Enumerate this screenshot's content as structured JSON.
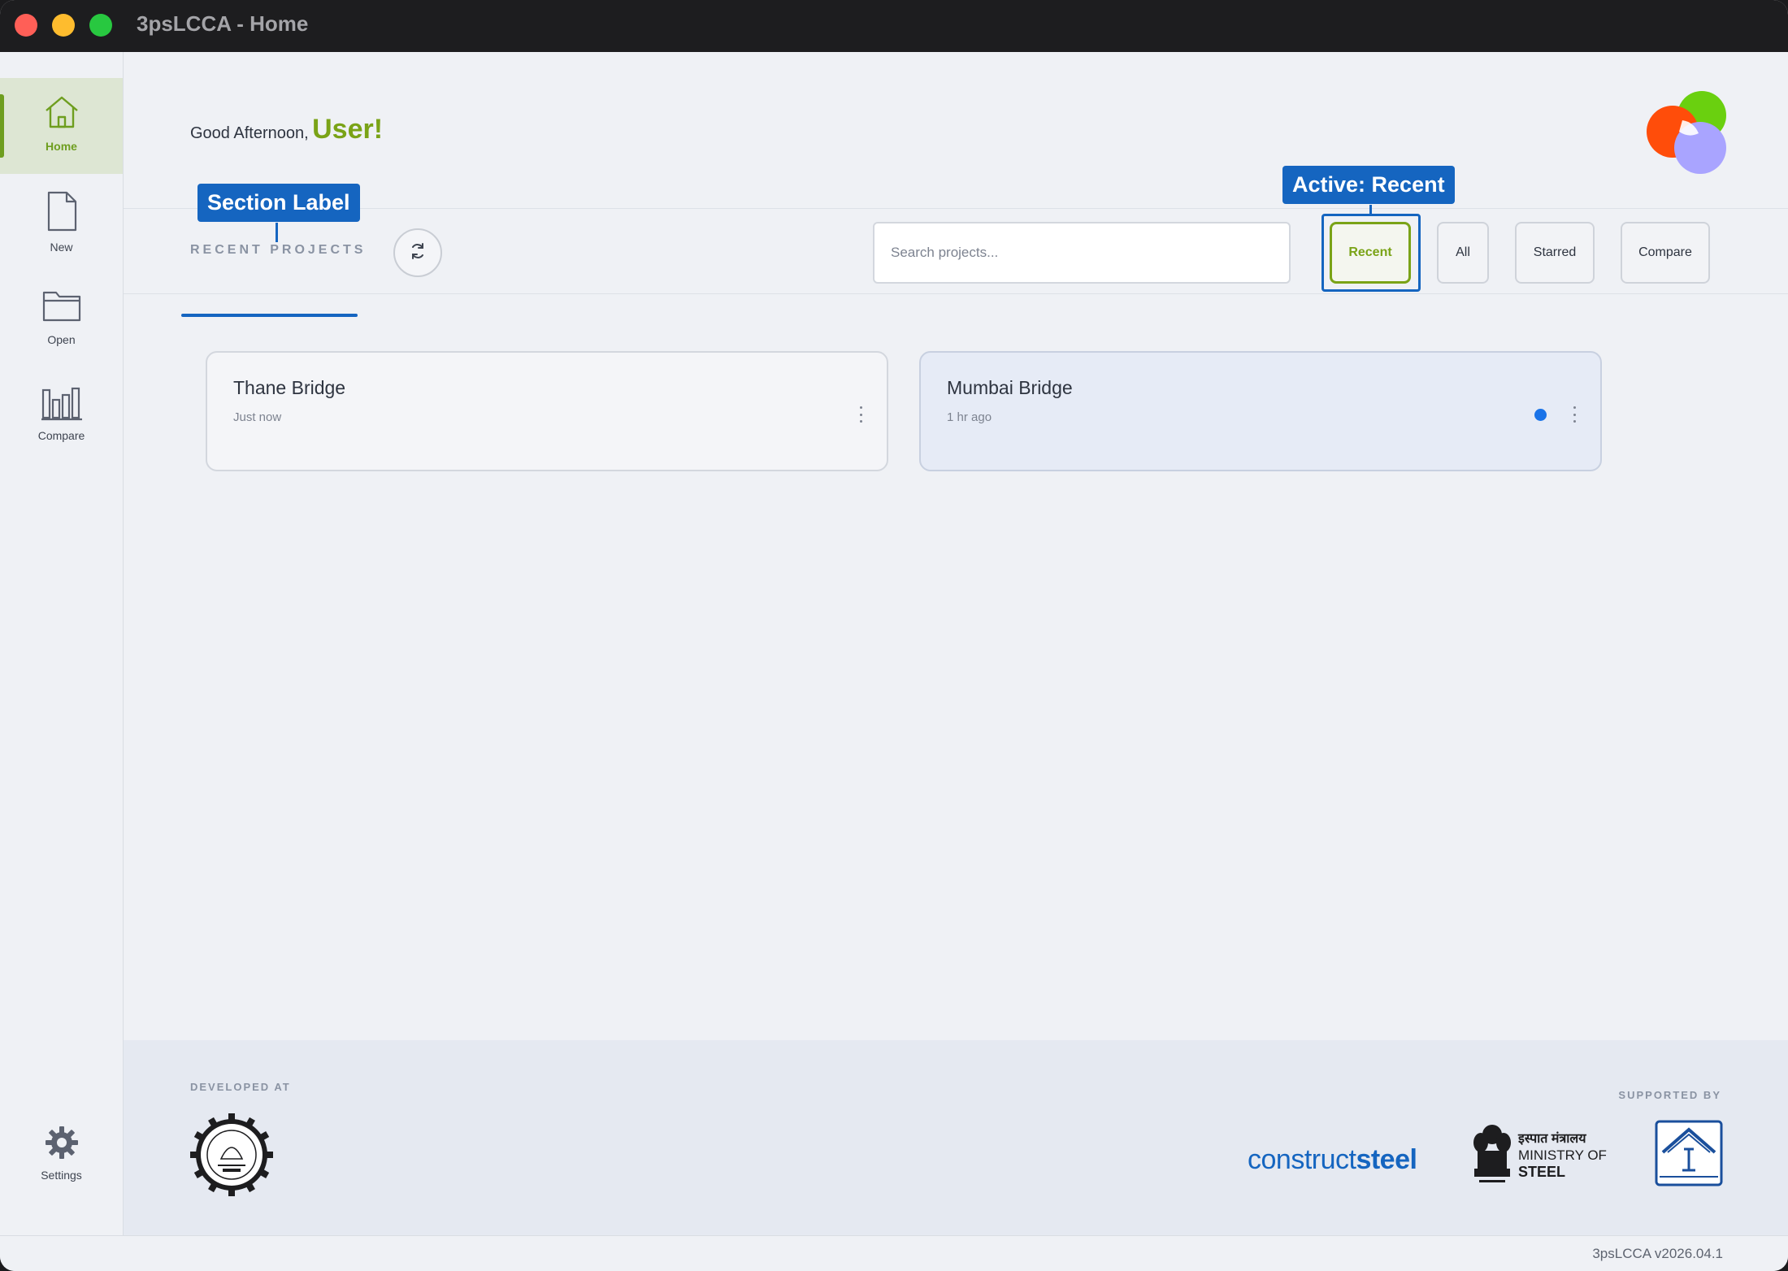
{
  "window": {
    "title": "3psLCCA - Home"
  },
  "sidebar": {
    "items": [
      {
        "label": "Home",
        "icon": "home-icon",
        "active": true
      },
      {
        "label": "New",
        "icon": "new-file-icon"
      },
      {
        "label": "Open",
        "icon": "folder-icon"
      },
      {
        "label": "Compare",
        "icon": "bar-chart-icon"
      }
    ],
    "settings": {
      "label": "Settings",
      "icon": "gear-icon"
    }
  },
  "header": {
    "greeting_prefix": "Good Afternoon,",
    "user_name": "User!"
  },
  "toolbar": {
    "section_label": "RECENT PROJECTS",
    "search_placeholder": "Search projects...",
    "filters": [
      "Recent",
      "All",
      "Starred",
      "Compare"
    ],
    "active_filter": "Recent"
  },
  "annotations": {
    "section_label": "Section Label",
    "active": "Active: Recent"
  },
  "projects": [
    {
      "name": "Thane Bridge",
      "time": "Just now",
      "unread": false
    },
    {
      "name": "Mumbai Bridge",
      "time": "1 hr ago",
      "unread": true
    }
  ],
  "footer": {
    "developed_at": "DEVELOPED AT",
    "supported_by": "SUPPORTED BY",
    "construct_prefix": "construct",
    "construct_suffix": "steel",
    "ministry_hi": "इस्पात मंत्रालय",
    "ministry_en": "MINISTRY OF",
    "ministry_steel": "STEEL"
  },
  "status": {
    "version": "3psLCCA v2026.04.1"
  },
  "colors": {
    "accent": "#7aa317",
    "annotation": "#1565c0",
    "unread_dot": "#1a73e8"
  }
}
